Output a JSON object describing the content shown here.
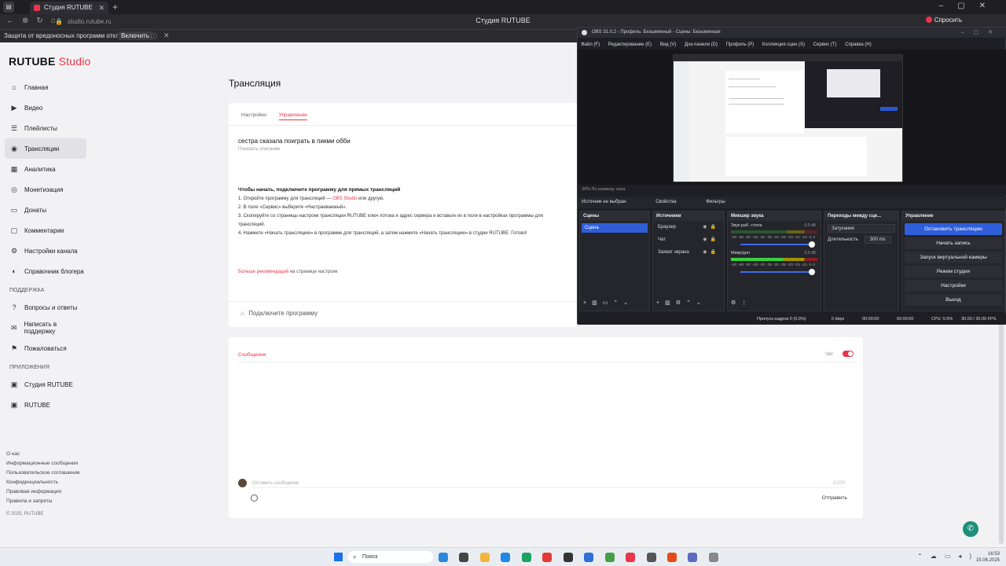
{
  "browser": {
    "tab_title": "Студия RUTUBE",
    "url": "studio.rutube.ru",
    "window_title": "Студия RUTUBE",
    "ask_label": "Спросить",
    "notice_text": "Защита от вредоносных программ отключена",
    "notice_button": "Включить"
  },
  "sidebar": {
    "logo_main": "RUTUBE",
    "logo_sub": "Studio",
    "items": [
      {
        "label": "Главная",
        "icon": "home-icon"
      },
      {
        "label": "Видео",
        "icon": "video-icon"
      },
      {
        "label": "Плейлисты",
        "icon": "playlist-icon"
      },
      {
        "label": "Трансляции",
        "icon": "broadcast-icon"
      },
      {
        "label": "Аналитика",
        "icon": "analytics-icon"
      },
      {
        "label": "Монетизация",
        "icon": "money-icon"
      },
      {
        "label": "Донаты",
        "icon": "donate-icon"
      },
      {
        "label": "Комментарии",
        "icon": "comments-icon"
      },
      {
        "label": "Настройки канала",
        "icon": "settings-icon"
      },
      {
        "label": "Справочник блогера",
        "icon": "guide-icon"
      }
    ],
    "support_title": "ПОДДЕРЖКА",
    "support_items": [
      {
        "label": "Вопросы и ответы"
      },
      {
        "label": "Написать в поддержку"
      },
      {
        "label": "Пожаловаться"
      }
    ],
    "apps_title": "ПРИЛОЖЕНИЯ",
    "apps_items": [
      {
        "label": "Студия RUTUBE"
      },
      {
        "label": "RUTUBE"
      }
    ],
    "footer": [
      "О нас",
      "Информационные сообщения",
      "Пользовательское соглашение",
      "Конфиденциальность",
      "Правовая информация",
      "Правила и запреты"
    ],
    "copyright": "© 2025, RUTUBE"
  },
  "main": {
    "title": "Трансляция",
    "tab_settings": "Настройки",
    "tab_control": "Управление",
    "stream_title": "сестра сказала поиграть в пикми обби",
    "show_desc": "Показать описание",
    "instr_head": "Чтобы начать, подключите программу для прямых трансляций",
    "instr_1a": "1. Откройте программу для трансляций — ",
    "instr_1_link": "OBS Studio",
    "instr_1b": " или другую.",
    "instr_2": "2. В поле «Сервис» выберите «Настраиваемый».",
    "instr_3": "3. Скопируйте со страницы настроек трансляции RUTUBE ключ потока и адрес сервера и вставьте их в поля в настройках программы для трансляций.",
    "instr_4": "4. Нажмите «Начать трансляцию» в программе для трансляций, а затем нажмите «Начать трансляцию» в студии RUTUBE. Готово!",
    "more_rec_link": "Больше рекомендаций",
    "more_rec_tail": " на странице настроек",
    "connect_label": "Подключите программу",
    "chat_title": "Сообщения",
    "chat_toggle_label": "Чат",
    "chat_placeholder": "Оставить сообщение",
    "chat_count": "0/200",
    "send_label": "Отправить"
  },
  "obs": {
    "title": "OBS 31.0.2 - Профиль: Безымянный - Сцены: Безымянная",
    "menu": [
      "Файл (F)",
      "Редактирование (E)",
      "Вид (V)",
      "Док-панели (D)",
      "Профиль (P)",
      "Коллекция сцен (S)",
      "Сервис (T)",
      "Справка (H)"
    ],
    "preview_status": "30%   По размеру окна",
    "source_none": "Источник не выбран",
    "props_label": "Свойства",
    "filters_label": "Фильтры",
    "scenes_title": "Сцены",
    "scene_active": "Сцена",
    "sources_title": "Источники",
    "sources": [
      "Браузер",
      "Чат",
      "Захват экрана"
    ],
    "mixer_title": "Микшер звука",
    "mixer": [
      {
        "name": "Звук раб. стола",
        "db": "0.0 dB"
      },
      {
        "name": "Микр/доп",
        "db": "0.0 dB"
      }
    ],
    "mixer_scale": "-60 -55 -50 -45 -40 -35 -30 -25 -20 -15 -10 -5 0",
    "transitions_title": "Переходы между сце...",
    "transition_value": "Затухание",
    "duration_label": "Длительность",
    "duration_value": "300 ms",
    "controls_title": "Управление",
    "controls": [
      "Остановить трансляцию",
      "Начать запись",
      "Запуск виртуальной камеры",
      "Режим студии",
      "Настройки",
      "Выход"
    ],
    "status_dropped": "Пропуск кадров 0 (0.0%)",
    "status_kbps": "0 kbps",
    "status_live": "00:00:00",
    "status_rec": "00:00:00",
    "status_cpu": "CPU: 0.5%",
    "status_fps": "30.00 / 30.00 FPS",
    "accent": "#2f5ed8"
  },
  "taskbar": {
    "search": "Поиск",
    "time": "16:53",
    "date": "15.06.2025"
  },
  "colors": {
    "brand_red": "#e8364c",
    "obs_accent": "#2f5ed8"
  }
}
